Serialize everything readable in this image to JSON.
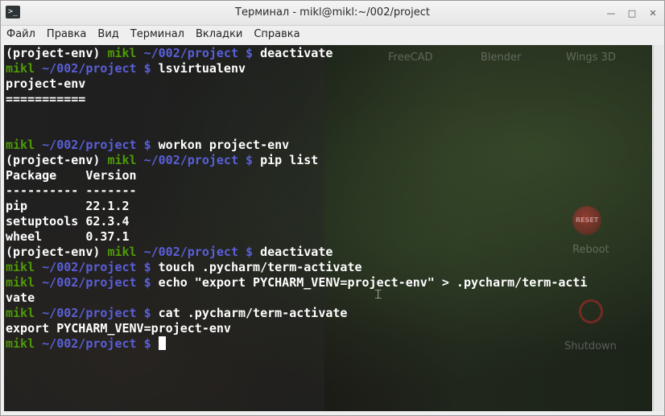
{
  "window": {
    "title": "Терминал - mikl@mikl:~/002/project",
    "icon": "terminal-icon"
  },
  "menu": [
    "Файл",
    "Правка",
    "Вид",
    "Терминал",
    "Вкладки",
    "Справка"
  ],
  "background_labels": {
    "freecad": "FreeCAD",
    "blender": "Blender",
    "wings": "Wings 3D",
    "reset": "RESET",
    "reboot": "Reboot",
    "shutdown": "Shutdown"
  },
  "terminal": {
    "user": "mikl",
    "path": "~/002/project",
    "dollar": "$",
    "lines": [
      {
        "env": "(project-env)",
        "cmd": "deactivate"
      },
      {
        "env": "",
        "cmd": "lsvirtualenv"
      },
      {
        "out": "project-env"
      },
      {
        "out": "==========="
      },
      {
        "out": ""
      },
      {
        "out": ""
      },
      {
        "env": "",
        "cmd": "workon project-env"
      },
      {
        "env": "(project-env)",
        "cmd": "pip list"
      },
      {
        "out": "Package    Version"
      },
      {
        "out": "---------- -------"
      },
      {
        "out": "pip        22.1.2"
      },
      {
        "out": "setuptools 62.3.4"
      },
      {
        "out": "wheel      0.37.1"
      },
      {
        "env": "(project-env)",
        "cmd": "deactivate"
      },
      {
        "env": "",
        "cmd": "touch .pycharm/term-activate"
      },
      {
        "env": "",
        "cmd": "echo \"export PYCHARM_VENV=project-env\" > .pycharm/term-acti"
      },
      {
        "out": "vate"
      },
      {
        "env": "",
        "cmd": "cat .pycharm/term-activate"
      },
      {
        "out": "export PYCHARM_VENV=project-env"
      },
      {
        "env": "",
        "cmd": "",
        "cursor": true
      }
    ]
  },
  "colors": {
    "user": "#4e9a06",
    "path": "#5a5fd8",
    "text": "#ffffff",
    "terminal_bg": "#0f0f0f"
  }
}
